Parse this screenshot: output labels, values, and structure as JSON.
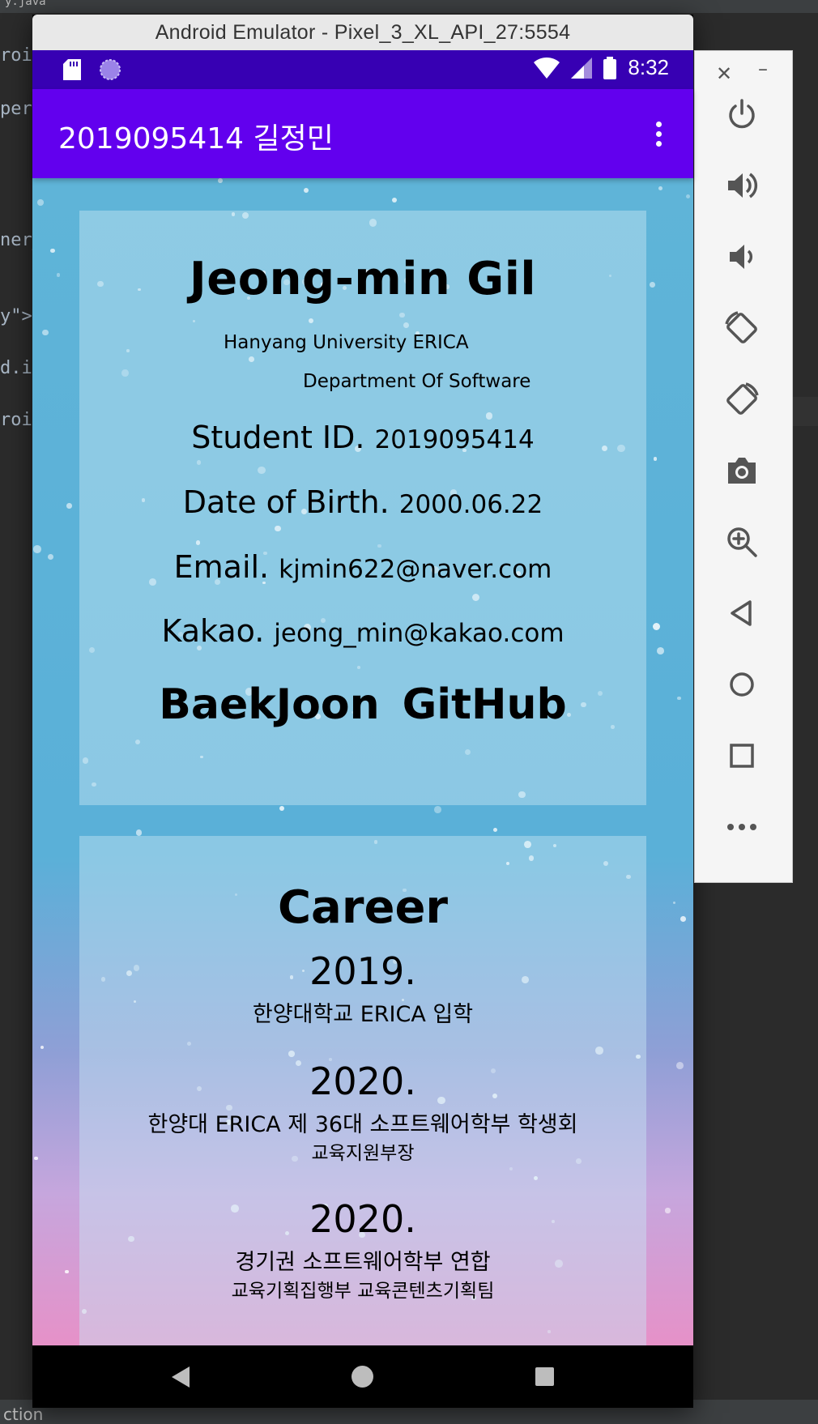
{
  "ide": {
    "top_text": "y.java",
    "code_lines": [
      "roid",
      "perm",
      "ner_",
      "y\">",
      "d.i",
      "roid"
    ],
    "bottom_text": "ction"
  },
  "window": {
    "title": "Android Emulator - Pixel_3_XL_API_27:5554"
  },
  "status_bar": {
    "time": "8:32"
  },
  "app_bar": {
    "title": "2019095414 길정민"
  },
  "profile": {
    "name": "Jeong-min Gil",
    "university": "Hanyang University ERICA",
    "department": "Department Of Software",
    "student_id_label": "Student ID.",
    "student_id": "2019095414",
    "birth_label": "Date of Birth.",
    "birth": "2000.06.22",
    "email_label": "Email.",
    "email": "kjmin622@naver.com",
    "kakao_label": "Kakao.",
    "kakao": "jeong_min@kakao.com",
    "link_baekjoon": "BaekJoon",
    "link_github": "GitHub"
  },
  "career": {
    "title": "Career",
    "entries": [
      {
        "year": "2019.",
        "text": "한양대학교 ERICA 입학",
        "sub": ""
      },
      {
        "year": "2020.",
        "text": "한양대 ERICA 제 36대 소프트웨어학부 학생회",
        "sub": "교육지원부장"
      },
      {
        "year": "2020.",
        "text": "경기권 소프트웨어학부 연합",
        "sub": "교육기획집행부 교육콘텐츠기획팀"
      }
    ]
  },
  "colors": {
    "status_bar": "#3700b3",
    "app_bar": "#6200ee",
    "bg_top": "#5fb4d8",
    "bg_bottom": "#e691c8"
  },
  "icons": {
    "toolbar": [
      "power-icon",
      "volume-up-icon",
      "volume-down-icon",
      "rotate-left-icon",
      "rotate-right-icon",
      "camera-icon",
      "zoom-icon",
      "back-icon",
      "home-icon",
      "overview-icon",
      "more-icon"
    ]
  }
}
